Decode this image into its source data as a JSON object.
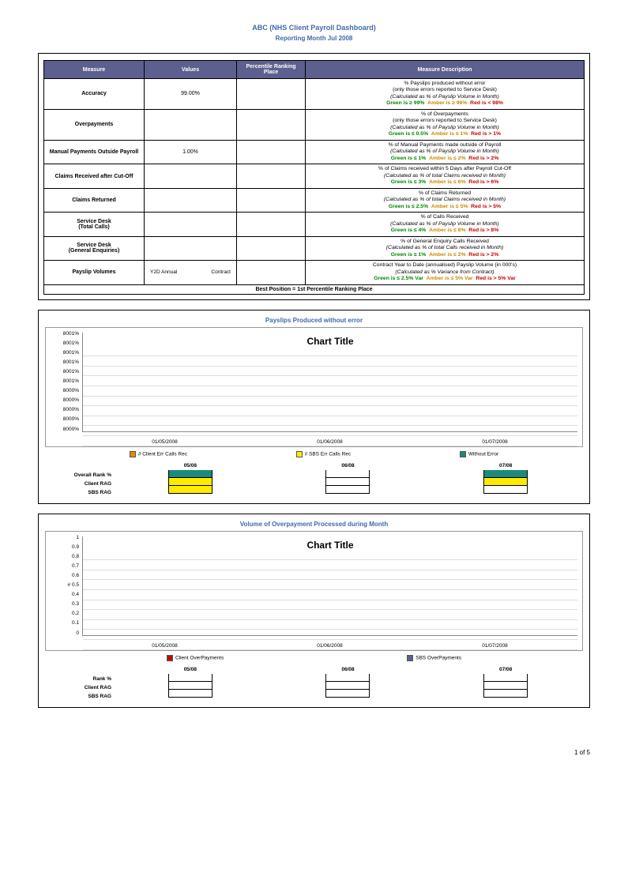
{
  "header": "ABC (NHS Client Payroll Dashboard)",
  "subheader": "Reporting Month Jul 2008",
  "footer": "1 of 5",
  "table": {
    "headers": [
      "Measure",
      "Values",
      "Percentile Ranking Place",
      "Measure Description"
    ],
    "best": "Best Position = 1st Percentile Ranking Place",
    "rows": [
      {
        "measure": "Accuracy",
        "value": "99.00%",
        "d1": "%  Payslips produced without error",
        "d2": "(only those errors reported to Service Desk)",
        "d3": "(Calculated as % of Payslip Volume in Month)",
        "g": "Green is ≥ 99%",
        "a": "Amber is ≥ 98%",
        "r": "Red is < 98%"
      },
      {
        "measure": "Overpayments",
        "value": "",
        "d1": "% of Overpayments",
        "d2": "(only those errors reported to Service Desk)",
        "d3": "(Calculated as % of Payslip Volume in Month)",
        "g": "Green is ≤ 0.5%",
        "a": "Amber is ≤ 1%",
        "r": "Red is > 1%"
      },
      {
        "measure": "Manual Payments Outside Payroll",
        "value": "1.00%",
        "d1": "% of Manual Payments made outside of Payroll",
        "d3": "(Calculated as % of Payslip Volume in Month)",
        "g": "Green is ≤ 1%",
        "a": "Amber is ≤ 2%",
        "r": "Red is > 2%"
      },
      {
        "measure": "Claims Received after Cut-Off",
        "value": "",
        "d1": "% of Claims received within 5 Days after Payroll Cut-Off",
        "d3": "(Calculated as % of total Claims received in Month)",
        "g": "Green is ≤ 3%",
        "a": "Amber is ≤ 6%",
        "r": "Red is > 6%"
      },
      {
        "measure": "Claims Returned",
        "value": "",
        "d1": "% of Claims Returned",
        "d3": "(Calculated as % of total Claims received in Month)",
        "g": "Green is ≤ 2.5%",
        "a": "Amber is ≤ 5%",
        "r": "Red is > 5%"
      },
      {
        "measure": "Service Desk\n(Total Calls)",
        "value": "",
        "d1": "% of Calls Received",
        "d3": "(Calculated as % of Payslip Volume in Month)",
        "g": "Green is ≤ 4%",
        "a": "Amber is ≤ 8%",
        "r": "Red is > 8%"
      },
      {
        "measure": "Service Desk\n(General Enquiries)",
        "value": "",
        "d1": "% of General Enquiry Calls Received",
        "d3": "(Calculated as % of total Calls received in Month)",
        "g": "Green is ≤ 1%",
        "a": "Amber is ≤ 2%",
        "r": "Red is > 2%"
      },
      {
        "measure": "Payslip Volumes",
        "value_split": [
          "Y2D Annual",
          "Contract"
        ],
        "d1": "Contract Year to Date (annualised) Payslip Volume (in 000's)",
        "d3": "(Calculated as % Variance from Contract)",
        "g": "Green is ≤ 2.5% Var",
        "a": "Amber is ≤ 5% Var",
        "r": "Red is > 5% Var"
      }
    ]
  },
  "chart1": {
    "title": "Payslips Produced without error",
    "inner": "Chart Title",
    "yticks": [
      "8001%",
      "8001%",
      "8001%",
      "8001%",
      "8001%",
      "8001%",
      "8000%",
      "8000%",
      "8000%",
      "8000%",
      "8000%"
    ],
    "xticks": [
      "01/05/2008",
      "01/06/2008",
      "01/07/2008"
    ],
    "legend": [
      {
        "color": "#e58a00",
        "label": "# Client Err Calls Rec"
      },
      {
        "color": "#ffeb00",
        "label": "# SBS Err Calls Rec"
      },
      {
        "color": "#1e8a7a",
        "label": "Without Error"
      }
    ],
    "rag": {
      "labels": [
        "Overall Rank %",
        "Client RAG",
        "SBS RAG"
      ],
      "months": [
        "05/08",
        "06/08",
        "07/08"
      ],
      "cells": [
        [
          "teal",
          "yellow",
          "yellow"
        ],
        [
          "",
          "",
          ""
        ],
        [
          "teal",
          "yellow",
          ""
        ]
      ]
    }
  },
  "chart2": {
    "title": "Volume of Overpayment Processed during Month",
    "inner": "Chart Title",
    "yticks": [
      "1",
      "0.9",
      "0.8",
      "0.7",
      "0.6",
      "# 0.5",
      "0.4",
      "0.3",
      "0.2",
      "0.1",
      "0"
    ],
    "xticks": [
      "01/05/2008",
      "01/06/2008",
      "01/07/2008"
    ],
    "legend": [
      {
        "color": "#cc0000",
        "label": "Client OverPayments"
      },
      {
        "color": "#5b608e",
        "label": "SBS OverPayments"
      }
    ],
    "rag": {
      "labels": [
        "Rank %",
        "Client RAG",
        "SBS RAG"
      ],
      "months": [
        "05/08",
        "06/08",
        "07/08"
      ],
      "cells": [
        [
          "",
          "",
          ""
        ],
        [
          "",
          "",
          ""
        ],
        [
          "",
          "",
          ""
        ]
      ]
    }
  },
  "chart_data": [
    {
      "type": "bar",
      "title": "Payslips Produced without error",
      "categories": [
        "01/05/2008",
        "01/06/2008",
        "01/07/2008"
      ],
      "series": [
        {
          "name": "# Client Err Calls Rec",
          "values": [
            null,
            null,
            null
          ]
        },
        {
          "name": "# SBS Err Calls Rec",
          "values": [
            null,
            null,
            null
          ]
        },
        {
          "name": "Without Error",
          "values": [
            null,
            null,
            null
          ]
        }
      ],
      "ylim": [
        8000,
        8001
      ]
    },
    {
      "type": "bar",
      "title": "Volume of Overpayment Processed during Month",
      "categories": [
        "01/05/2008",
        "01/06/2008",
        "01/07/2008"
      ],
      "series": [
        {
          "name": "Client OverPayments",
          "values": [
            null,
            null,
            null
          ]
        },
        {
          "name": "SBS OverPayments",
          "values": [
            null,
            null,
            null
          ]
        }
      ],
      "ylim": [
        0,
        1
      ]
    }
  ]
}
